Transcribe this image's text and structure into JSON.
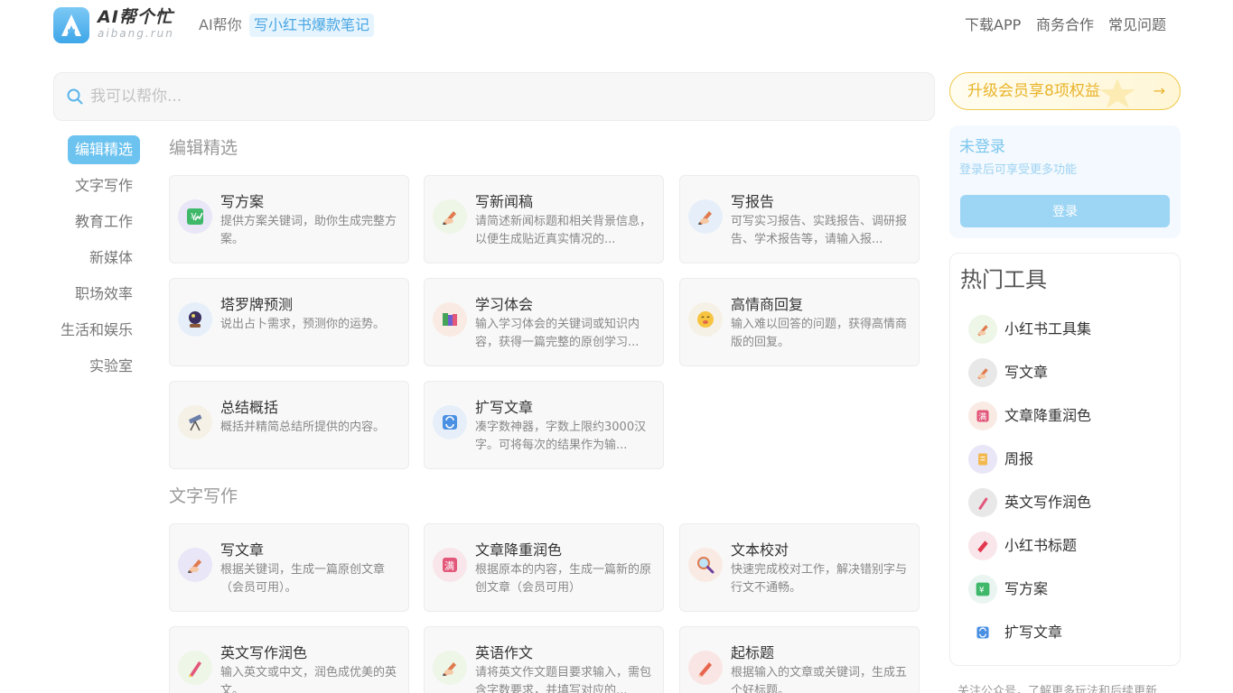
{
  "header": {
    "brand_name": "AI帮个忙",
    "brand_sub": "aibang.run",
    "tagline": "AI帮你",
    "tagline_highlight": "写小红书爆款笔记",
    "nav": [
      "下载APP",
      "商务合作",
      "常见问题"
    ]
  },
  "search": {
    "placeholder": "我可以帮你..."
  },
  "sidebar": {
    "items": [
      "编辑精选",
      "文字写作",
      "教育工作",
      "新媒体",
      "职场效率",
      "生活和娱乐",
      "实验室"
    ],
    "active": "编辑精选"
  },
  "sections": [
    {
      "title": "编辑精选",
      "cards": [
        {
          "title": "写方案",
          "desc": "提供方案关键词，助你生成完整方案。",
          "icon": "money-chart-icon"
        },
        {
          "title": "写新闻稿",
          "desc": "请简述新闻标题和相关背景信息，以便生成贴近真实情况的...",
          "icon": "writing-hand-icon"
        },
        {
          "title": "写报告",
          "desc": "可写实习报告、实践报告、调研报告、学术报告等，请输入报...",
          "icon": "writing-hand-icon"
        },
        {
          "title": "塔罗牌预测",
          "desc": "说出占卜需求，预测你的运势。",
          "icon": "crystal-ball-icon"
        },
        {
          "title": "学习体会",
          "desc": "输入学习体会的关键词或知识内容，获得一篇完整的原创学习...",
          "icon": "books-icon"
        },
        {
          "title": "高情商回复",
          "desc": "输入难以回答的问题，获得高情商版的回复。",
          "icon": "smile-face-icon"
        },
        {
          "title": "总结概括",
          "desc": "概括并精简总结所提供的内容。",
          "icon": "telescope-icon"
        },
        {
          "title": "扩写文章",
          "desc": "凑字数神器，字数上限约3000汉字。可将每次的结果作为输...",
          "icon": "repeat-icon"
        }
      ]
    },
    {
      "title": "文字写作",
      "cards": [
        {
          "title": "写文章",
          "desc": "根据关键词，生成一篇原创文章（会员可用）。",
          "icon": "writing-hand-icon"
        },
        {
          "title": "文章降重润色",
          "desc": "根据原本的内容，生成一篇新的原创文章（会员可用）",
          "icon": "full-badge-icon"
        },
        {
          "title": "文本校对",
          "desc": "快速完成校对工作，解决错别字与行文不通畅。",
          "icon": "magnifier-icon"
        },
        {
          "title": "英文写作润色",
          "desc": "输入英文或中文，润色成优美的英文。",
          "icon": "crayon-icon"
        },
        {
          "title": "英语作文",
          "desc": "请将英文作文题目要求输入，需包含字数要求，并填写对应的...",
          "icon": "writing-hand-icon"
        },
        {
          "title": "起标题",
          "desc": "根据输入的文章或关键词，生成五个好标题。",
          "icon": "pencil-icon"
        }
      ]
    }
  ],
  "upgrade": {
    "label": "升级会员享8项权益",
    "arrow": "→"
  },
  "login": {
    "title": "未登录",
    "subtitle": "登录后可享受更多功能",
    "button": "登录"
  },
  "hot_tools": {
    "title": "热门工具",
    "items": [
      {
        "label": "小红书工具集",
        "icon": "writing-hand-icon"
      },
      {
        "label": "写文章",
        "icon": "writing-hand-icon"
      },
      {
        "label": "文章降重润色",
        "icon": "full-badge-icon"
      },
      {
        "label": "周报",
        "icon": "scroll-icon"
      },
      {
        "label": "英文写作润色",
        "icon": "crayon-icon"
      },
      {
        "label": "小红书标题",
        "icon": "bookmark-icon"
      },
      {
        "label": "写方案",
        "icon": "money-chart-icon"
      },
      {
        "label": "扩写文章",
        "icon": "repeat-icon"
      }
    ]
  },
  "footer_note": "关注公众号，了解更多玩法和后续更新"
}
